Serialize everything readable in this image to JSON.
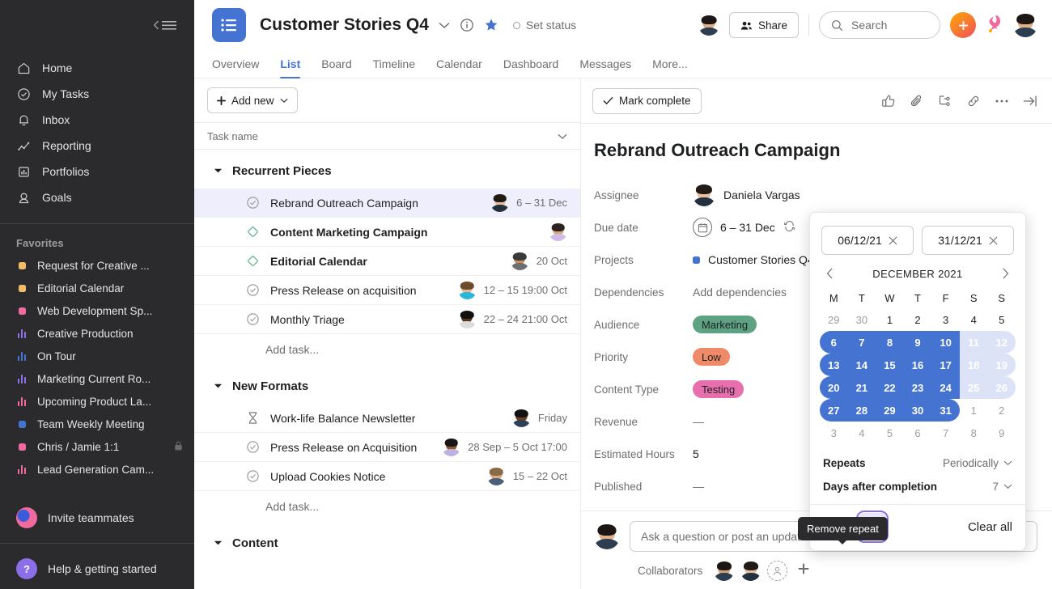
{
  "sidebar": {
    "collapse_label": "collapse-sidebar",
    "nav": [
      {
        "label": "Home",
        "icon": "home-icon"
      },
      {
        "label": "My Tasks",
        "icon": "check-circle-icon"
      },
      {
        "label": "Inbox",
        "icon": "bell-icon"
      },
      {
        "label": "Reporting",
        "icon": "line-chart-icon"
      },
      {
        "label": "Portfolios",
        "icon": "portfolio-icon"
      },
      {
        "label": "Goals",
        "icon": "goal-icon"
      }
    ],
    "favorites_header": "Favorites",
    "favorites": [
      {
        "label": "Request for Creative ...",
        "icon": "dot",
        "color": "#f1bd6c",
        "locked": false
      },
      {
        "label": "Editorial Calendar",
        "icon": "dot",
        "color": "#f1bd6c",
        "locked": false
      },
      {
        "label": "Web Development Sp...",
        "icon": "dot",
        "color": "#f06a9f",
        "locked": false
      },
      {
        "label": "Creative Production",
        "icon": "bars",
        "color": "#8b6ee8",
        "locked": false
      },
      {
        "label": "On Tour",
        "icon": "bars",
        "color": "#4573d2",
        "locked": false
      },
      {
        "label": "Marketing Current Ro...",
        "icon": "bars",
        "color": "#8b6ee8",
        "locked": false
      },
      {
        "label": "Upcoming Product La...",
        "icon": "bars",
        "color": "#f06a9f",
        "locked": false
      },
      {
        "label": "Team Weekly Meeting",
        "icon": "dot",
        "color": "#4573d2",
        "locked": false
      },
      {
        "label": "Chris / Jamie 1:1",
        "icon": "dot",
        "color": "#f06a9f",
        "locked": true
      },
      {
        "label": "Lead Generation Cam...",
        "icon": "bars",
        "color": "#f06a9f",
        "locked": false
      }
    ],
    "invite_label": "Invite teammates",
    "help_label": "Help & getting started",
    "help_glyph": "?"
  },
  "header": {
    "project_title": "Customer Stories Q4",
    "project_icon": "list-icon",
    "chevron_icon": "chevron-down-icon",
    "info_icon": "info-icon",
    "star_icon": "star-icon",
    "set_status": "Set status",
    "share_label": "Share",
    "search_placeholder": "Search",
    "plus_icon": "plus-icon",
    "tabs": [
      {
        "label": "Overview",
        "active": false
      },
      {
        "label": "List",
        "active": true
      },
      {
        "label": "Board",
        "active": false
      },
      {
        "label": "Timeline",
        "active": false
      },
      {
        "label": "Calendar",
        "active": false
      },
      {
        "label": "Dashboard",
        "active": false
      },
      {
        "label": "Messages",
        "active": false
      },
      {
        "label": "More...",
        "active": false
      }
    ]
  },
  "list": {
    "add_new_label": "Add new",
    "column_header": "Task name",
    "add_task_label": "Add task...",
    "sections": [
      {
        "title": "Recurrent Pieces",
        "tasks": [
          {
            "name": "Rebrand Outreach Campaign",
            "state": "check-circle",
            "date": "6 – 31 Dec",
            "selected": true,
            "bold": false,
            "skin": "#e8bfa0",
            "hair": "#221a16",
            "cloth": "#23313f"
          },
          {
            "name": "Content Marketing Campaign",
            "state": "milestone",
            "date": "",
            "selected": false,
            "bold": true,
            "skin": "#d8a87e",
            "hair": "#2c2320",
            "cloth": "#cdbde8"
          },
          {
            "name": "Editorial Calendar",
            "state": "milestone",
            "date": "20 Oct",
            "selected": false,
            "bold": true,
            "skin": "#c98f63",
            "hair": "#3a3a3a",
            "cloth": "#6d6e6f"
          },
          {
            "name": "Press Release on acquisition",
            "state": "check-circle",
            "date": "12 – 15 19:00 Oct",
            "selected": false,
            "bold": false,
            "skin": "#e6b894",
            "hair": "#6b4b2a",
            "cloth": "#29b6d8"
          },
          {
            "name": "Monthly Triage",
            "state": "check-circle",
            "date": "22 – 24 21:00 Oct",
            "selected": false,
            "bold": false,
            "skin": "#57391f",
            "hair": "#12100e",
            "cloth": "#dcdcdc"
          }
        ]
      },
      {
        "title": "New Formats",
        "tasks": [
          {
            "name": "Work-life Balance Newsletter",
            "state": "approval",
            "date": "Friday",
            "selected": false,
            "bold": false,
            "skin": "#6b3f22",
            "hair": "#141210",
            "cloth": "#2f4054"
          },
          {
            "name": "Press Release on Acquisition",
            "state": "check-circle",
            "date": "28 Sep – 5 Oct 17:00",
            "selected": false,
            "bold": false,
            "skin": "#8a5a33",
            "hair": "#1a1512",
            "cloth": "#bfb0e0"
          },
          {
            "name": "Upload Cookies Notice",
            "state": "check-circle",
            "date": "15 – 22 Oct",
            "selected": false,
            "bold": false,
            "skin": "#dcae86",
            "hair": "#8a6b45",
            "cloth": "#4b5f78"
          }
        ]
      },
      {
        "title": "Content",
        "tasks": []
      }
    ]
  },
  "detail": {
    "mark_complete_label": "Mark complete",
    "icons": [
      "thumbs-up-icon",
      "paperclip-icon",
      "subtask-icon",
      "link-icon",
      "ellipsis-icon",
      "collapse-panel-icon"
    ],
    "task_title": "Rebrand Outreach Campaign",
    "fields": [
      {
        "label": "Assignee",
        "value": "Daniela Vargas",
        "type": "person"
      },
      {
        "label": "Due date",
        "value": "6 – 31 Dec",
        "type": "date"
      },
      {
        "label": "Projects",
        "value": "Customer Stories Q4",
        "type": "project"
      },
      {
        "label": "Dependencies",
        "value": "Add dependencies",
        "type": "muted"
      },
      {
        "label": "Audience",
        "value": "Marketing",
        "type": "pill",
        "color": "#5da283"
      },
      {
        "label": "Priority",
        "value": "Low",
        "type": "pill",
        "color": "#ef8a68"
      },
      {
        "label": "Content Type",
        "value": "Testing",
        "type": "pill",
        "color": "#e86fae"
      },
      {
        "label": "Revenue",
        "value": "—",
        "type": "muted"
      },
      {
        "label": "Estimated Hours",
        "value": "5",
        "type": "text"
      },
      {
        "label": "Published",
        "value": "—",
        "type": "muted"
      }
    ],
    "comment_placeholder": "Ask a question or post an update",
    "collaborators_label": "Collaborators"
  },
  "datepicker": {
    "start_date": "06/12/21",
    "end_date": "31/12/21",
    "clear_icon": "close-icon",
    "prev_icon": "chevron-left-icon",
    "next_icon": "chevron-right-icon",
    "month_label": "DECEMBER 2021",
    "dow": [
      "M",
      "T",
      "W",
      "T",
      "F",
      "S",
      "S"
    ],
    "weeks": [
      [
        {
          "d": "29",
          "s": "out"
        },
        {
          "d": "30",
          "s": "out"
        },
        {
          "d": "1",
          "s": ""
        },
        {
          "d": "2",
          "s": ""
        },
        {
          "d": "3",
          "s": ""
        },
        {
          "d": "4",
          "s": ""
        },
        {
          "d": "5",
          "s": ""
        }
      ],
      [
        {
          "d": "6",
          "s": "sel start"
        },
        {
          "d": "7",
          "s": "sel"
        },
        {
          "d": "8",
          "s": "sel"
        },
        {
          "d": "9",
          "s": "sel"
        },
        {
          "d": "10",
          "s": "sel"
        },
        {
          "d": "11",
          "s": "selwk"
        },
        {
          "d": "12",
          "s": "selwk end"
        }
      ],
      [
        {
          "d": "13",
          "s": "sel start"
        },
        {
          "d": "14",
          "s": "sel"
        },
        {
          "d": "15",
          "s": "sel"
        },
        {
          "d": "16",
          "s": "sel"
        },
        {
          "d": "17",
          "s": "sel"
        },
        {
          "d": "18",
          "s": "selwk"
        },
        {
          "d": "19",
          "s": "selwk end"
        }
      ],
      [
        {
          "d": "20",
          "s": "sel start"
        },
        {
          "d": "21",
          "s": "sel"
        },
        {
          "d": "22",
          "s": "sel"
        },
        {
          "d": "23",
          "s": "sel"
        },
        {
          "d": "24",
          "s": "sel"
        },
        {
          "d": "25",
          "s": "selwk"
        },
        {
          "d": "26",
          "s": "selwk end"
        }
      ],
      [
        {
          "d": "27",
          "s": "sel start"
        },
        {
          "d": "28",
          "s": "sel"
        },
        {
          "d": "29",
          "s": "sel"
        },
        {
          "d": "30",
          "s": "sel"
        },
        {
          "d": "31",
          "s": "sel end"
        },
        {
          "d": "1",
          "s": "out"
        },
        {
          "d": "2",
          "s": "out"
        }
      ],
      [
        {
          "d": "3",
          "s": "out"
        },
        {
          "d": "4",
          "s": "out"
        },
        {
          "d": "5",
          "s": "out"
        },
        {
          "d": "6",
          "s": "out"
        },
        {
          "d": "7",
          "s": "out"
        },
        {
          "d": "8",
          "s": "out"
        },
        {
          "d": "9",
          "s": "out"
        }
      ]
    ],
    "repeats_label": "Repeats",
    "repeats_value": "Periodically",
    "days_after_label": "Days after completion",
    "days_after_value": "7",
    "clear_all_label": "Clear all",
    "time_icon": "clock-icon",
    "repeat_icon": "repeat-icon"
  },
  "tooltip": {
    "text": "Remove repeat"
  },
  "colors": {
    "accent": "#4573d2",
    "sidebar_bg": "#2b2b2d",
    "selected_row": "#eeeefc"
  }
}
